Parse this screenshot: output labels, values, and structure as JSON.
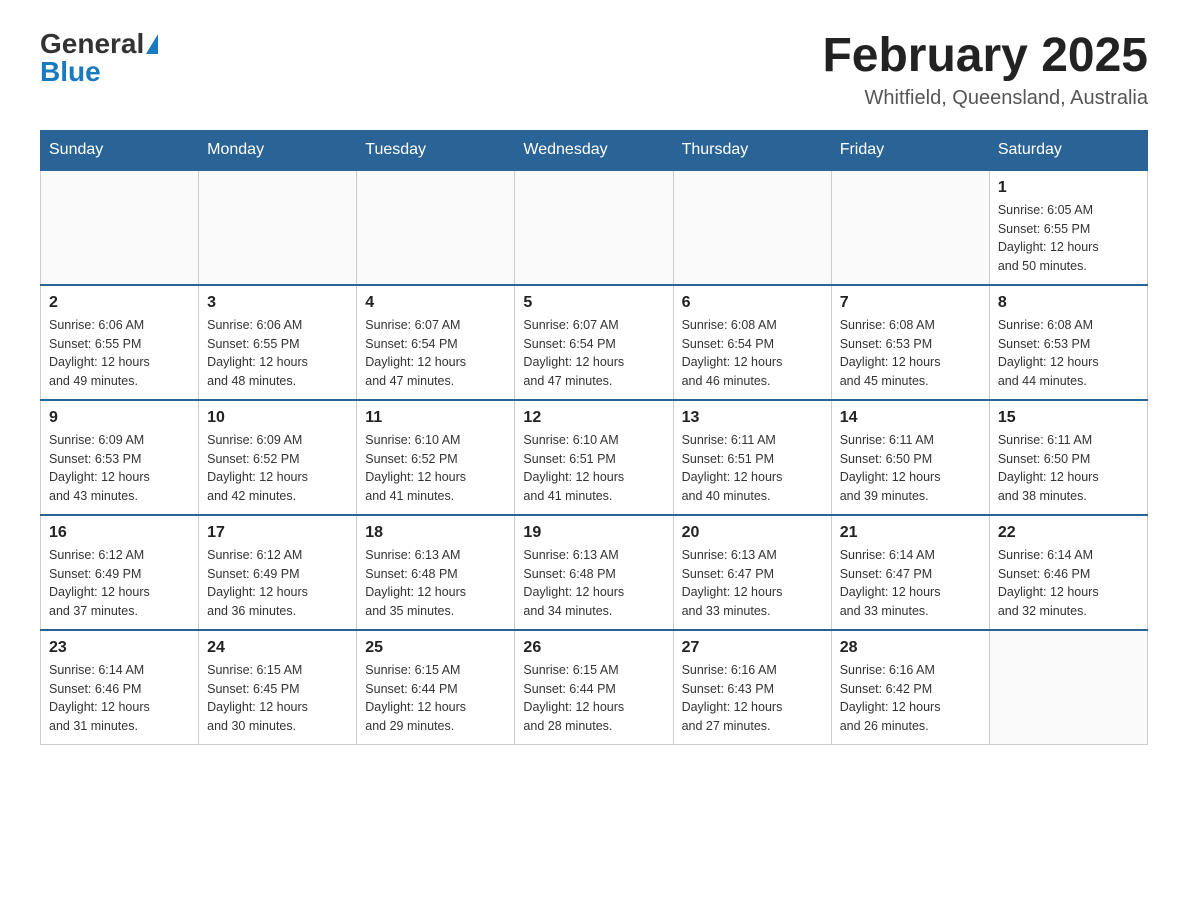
{
  "logo": {
    "general": "General",
    "blue": "Blue"
  },
  "title": "February 2025",
  "location": "Whitfield, Queensland, Australia",
  "days_of_week": [
    "Sunday",
    "Monday",
    "Tuesday",
    "Wednesday",
    "Thursday",
    "Friday",
    "Saturday"
  ],
  "weeks": [
    {
      "days": [
        {
          "date": "",
          "info": ""
        },
        {
          "date": "",
          "info": ""
        },
        {
          "date": "",
          "info": ""
        },
        {
          "date": "",
          "info": ""
        },
        {
          "date": "",
          "info": ""
        },
        {
          "date": "",
          "info": ""
        },
        {
          "date": "1",
          "info": "Sunrise: 6:05 AM\nSunset: 6:55 PM\nDaylight: 12 hours\nand 50 minutes."
        }
      ]
    },
    {
      "days": [
        {
          "date": "2",
          "info": "Sunrise: 6:06 AM\nSunset: 6:55 PM\nDaylight: 12 hours\nand 49 minutes."
        },
        {
          "date": "3",
          "info": "Sunrise: 6:06 AM\nSunset: 6:55 PM\nDaylight: 12 hours\nand 48 minutes."
        },
        {
          "date": "4",
          "info": "Sunrise: 6:07 AM\nSunset: 6:54 PM\nDaylight: 12 hours\nand 47 minutes."
        },
        {
          "date": "5",
          "info": "Sunrise: 6:07 AM\nSunset: 6:54 PM\nDaylight: 12 hours\nand 47 minutes."
        },
        {
          "date": "6",
          "info": "Sunrise: 6:08 AM\nSunset: 6:54 PM\nDaylight: 12 hours\nand 46 minutes."
        },
        {
          "date": "7",
          "info": "Sunrise: 6:08 AM\nSunset: 6:53 PM\nDaylight: 12 hours\nand 45 minutes."
        },
        {
          "date": "8",
          "info": "Sunrise: 6:08 AM\nSunset: 6:53 PM\nDaylight: 12 hours\nand 44 minutes."
        }
      ]
    },
    {
      "days": [
        {
          "date": "9",
          "info": "Sunrise: 6:09 AM\nSunset: 6:53 PM\nDaylight: 12 hours\nand 43 minutes."
        },
        {
          "date": "10",
          "info": "Sunrise: 6:09 AM\nSunset: 6:52 PM\nDaylight: 12 hours\nand 42 minutes."
        },
        {
          "date": "11",
          "info": "Sunrise: 6:10 AM\nSunset: 6:52 PM\nDaylight: 12 hours\nand 41 minutes."
        },
        {
          "date": "12",
          "info": "Sunrise: 6:10 AM\nSunset: 6:51 PM\nDaylight: 12 hours\nand 41 minutes."
        },
        {
          "date": "13",
          "info": "Sunrise: 6:11 AM\nSunset: 6:51 PM\nDaylight: 12 hours\nand 40 minutes."
        },
        {
          "date": "14",
          "info": "Sunrise: 6:11 AM\nSunset: 6:50 PM\nDaylight: 12 hours\nand 39 minutes."
        },
        {
          "date": "15",
          "info": "Sunrise: 6:11 AM\nSunset: 6:50 PM\nDaylight: 12 hours\nand 38 minutes."
        }
      ]
    },
    {
      "days": [
        {
          "date": "16",
          "info": "Sunrise: 6:12 AM\nSunset: 6:49 PM\nDaylight: 12 hours\nand 37 minutes."
        },
        {
          "date": "17",
          "info": "Sunrise: 6:12 AM\nSunset: 6:49 PM\nDaylight: 12 hours\nand 36 minutes."
        },
        {
          "date": "18",
          "info": "Sunrise: 6:13 AM\nSunset: 6:48 PM\nDaylight: 12 hours\nand 35 minutes."
        },
        {
          "date": "19",
          "info": "Sunrise: 6:13 AM\nSunset: 6:48 PM\nDaylight: 12 hours\nand 34 minutes."
        },
        {
          "date": "20",
          "info": "Sunrise: 6:13 AM\nSunset: 6:47 PM\nDaylight: 12 hours\nand 33 minutes."
        },
        {
          "date": "21",
          "info": "Sunrise: 6:14 AM\nSunset: 6:47 PM\nDaylight: 12 hours\nand 33 minutes."
        },
        {
          "date": "22",
          "info": "Sunrise: 6:14 AM\nSunset: 6:46 PM\nDaylight: 12 hours\nand 32 minutes."
        }
      ]
    },
    {
      "days": [
        {
          "date": "23",
          "info": "Sunrise: 6:14 AM\nSunset: 6:46 PM\nDaylight: 12 hours\nand 31 minutes."
        },
        {
          "date": "24",
          "info": "Sunrise: 6:15 AM\nSunset: 6:45 PM\nDaylight: 12 hours\nand 30 minutes."
        },
        {
          "date": "25",
          "info": "Sunrise: 6:15 AM\nSunset: 6:44 PM\nDaylight: 12 hours\nand 29 minutes."
        },
        {
          "date": "26",
          "info": "Sunrise: 6:15 AM\nSunset: 6:44 PM\nDaylight: 12 hours\nand 28 minutes."
        },
        {
          "date": "27",
          "info": "Sunrise: 6:16 AM\nSunset: 6:43 PM\nDaylight: 12 hours\nand 27 minutes."
        },
        {
          "date": "28",
          "info": "Sunrise: 6:16 AM\nSunset: 6:42 PM\nDaylight: 12 hours\nand 26 minutes."
        },
        {
          "date": "",
          "info": ""
        }
      ]
    }
  ]
}
